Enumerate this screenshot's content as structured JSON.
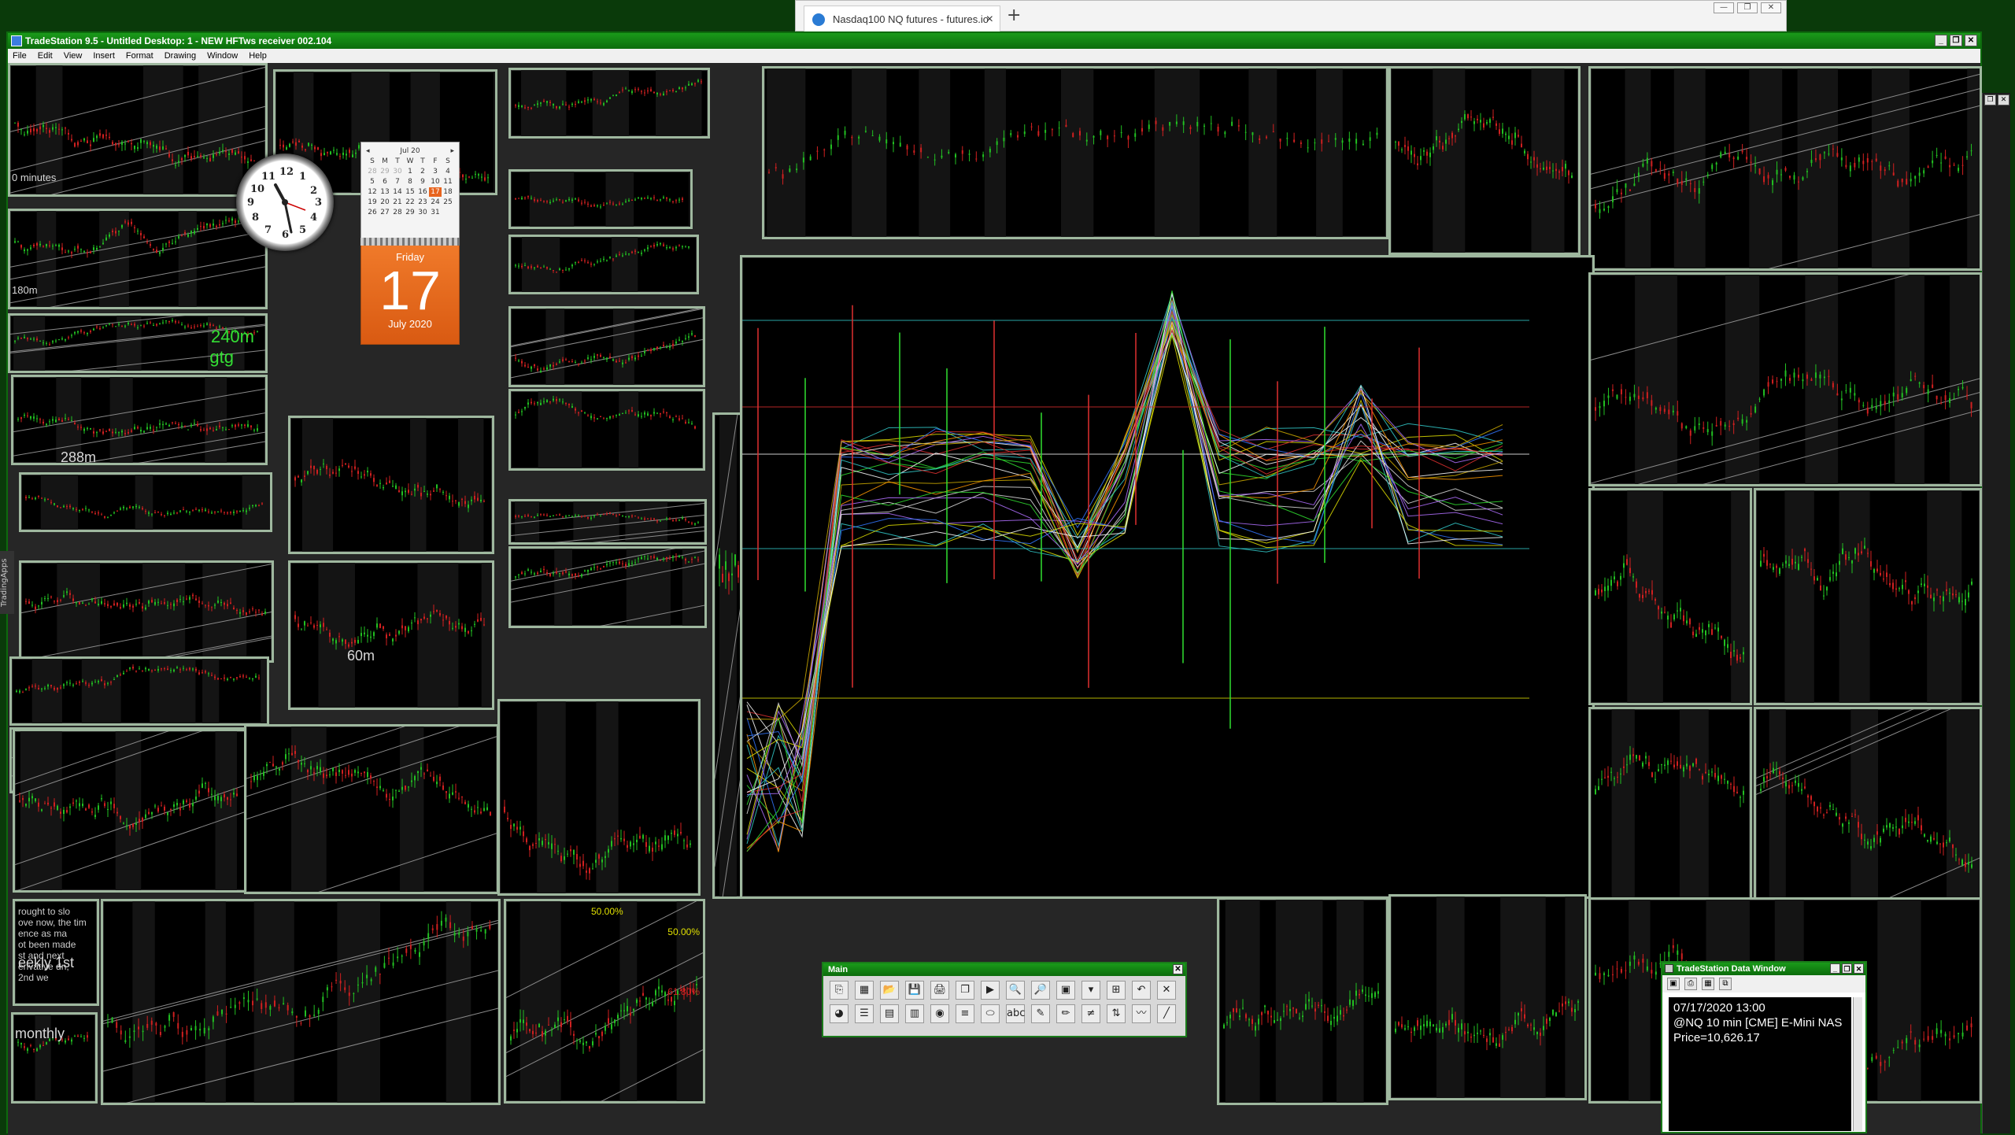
{
  "browser": {
    "tab_title": "Nasdaq100 NQ futures - futures.io",
    "tab_close": "×",
    "new_tab": "+",
    "controls": [
      "—",
      "❐",
      "✕"
    ]
  },
  "app": {
    "title": "TradeStation 9.5 - Untitled Desktop: 1 - NEW HFTws receiver 002.104",
    "controls": [
      "_",
      "❐",
      "✕"
    ],
    "menu": [
      "File",
      "Edit",
      "View",
      "Insert",
      "Format",
      "Drawing",
      "Window",
      "Help"
    ]
  },
  "chart_labels": {
    "zero_minutes": "0 minutes",
    "m180": "180m",
    "m240": "240m",
    "gtg": "gtg",
    "m288": "288m",
    "m60": "60m",
    "weekly": "eekly 1st",
    "monthly": "monthly",
    "pct50_a": "50.00%",
    "pct50_b": "50.00%",
    "pct61": "61.80%",
    "note_lines": [
      "rought to slo",
      "ove now, the tim",
      "ence as ma",
      "ot been made",
      "st and next",
      "erivative dn,",
      "2nd we"
    ]
  },
  "clock": {
    "numbers": [
      "12",
      "1",
      "2",
      "3",
      "4",
      "5",
      "6",
      "7",
      "8",
      "9",
      "10",
      "11"
    ]
  },
  "calendar": {
    "month_label": "Jul 20",
    "nav_prev": "◂",
    "nav_next": "▸",
    "weekdays": [
      "S",
      "M",
      "T",
      "W",
      "T",
      "F",
      "S"
    ],
    "days": [
      "28",
      "29",
      "30",
      "1",
      "2",
      "3",
      "4",
      "5",
      "6",
      "7",
      "8",
      "9",
      "10",
      "11",
      "12",
      "13",
      "14",
      "15",
      "16",
      "17",
      "18",
      "19",
      "20",
      "21",
      "22",
      "23",
      "24",
      "25",
      "26",
      "27",
      "28",
      "29",
      "30",
      "31",
      ""
    ],
    "weekday": "Friday",
    "day": "17",
    "month_year": "July 2020"
  },
  "toolbar": {
    "title": "Main",
    "close": "✕",
    "row1_icons": [
      "new-window-icon",
      "chart-analysis-icon",
      "open-icon",
      "save-icon",
      "print-icon",
      "copy-icon",
      "next-bar-icon",
      "zoom-in-icon",
      "zoom-out-icon",
      "chart-style-icon",
      "dropdown-icon",
      "grid-icon",
      "curve-icon",
      "pointer-icon"
    ],
    "row1_glyphs": [
      "⎘",
      "▦",
      "📂",
      "💾",
      "🖨",
      "❐",
      "▶",
      "🔍",
      "🔎",
      "▣",
      "▾",
      "⊞",
      "↶",
      "✕"
    ],
    "row2_icons": [
      "indicator-icon",
      "list-icon",
      "data-icon",
      "strategy-icon",
      "disk-icon",
      "lines-icon",
      "ellipse-icon",
      "text-icon",
      "highlight-icon",
      "pencil-icon",
      "fib-icon",
      "fib-ext-icon",
      "wave-icon",
      "trendline-icon"
    ],
    "row2_glyphs": [
      "◕",
      "☰",
      "▤",
      "▥",
      "◉",
      "≡",
      "⬭",
      "abc",
      "✎",
      "✏",
      "≠",
      "⇅",
      "〰",
      "╱"
    ]
  },
  "data_window": {
    "title": "TradeStation Data Window",
    "controls": [
      "_",
      "❐",
      "✕"
    ],
    "tool_icons": [
      "▣",
      "⎙",
      "▦",
      "⧉"
    ],
    "lines": [
      "07/17/2020 13:00",
      "@NQ 10 min [CME] E-Mini NAS",
      "Price=10,626.17"
    ]
  },
  "sidebar": {
    "tradingapps": "TradingApps"
  },
  "colors": {
    "frame": "#9fb89f",
    "bull": "#22c022",
    "bear": "#d02020",
    "accent": "#e8641e"
  }
}
